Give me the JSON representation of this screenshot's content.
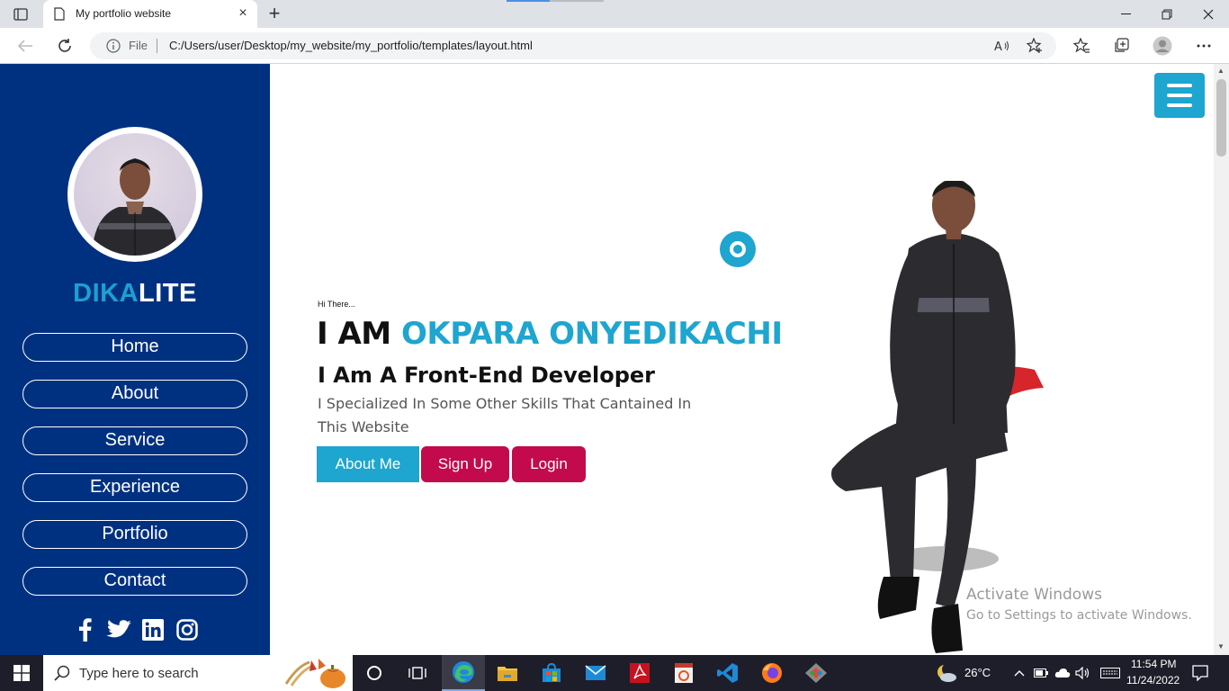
{
  "browser": {
    "tab_title": "My portfolio website",
    "new_tab": "+",
    "close_tab": "×",
    "address_label": "File",
    "url": "C:/Users/user/Desktop/my_website/my_portfolio/templates/layout.html"
  },
  "site": {
    "brand_part1": "DIKA",
    "brand_part2": "LITE",
    "nav": [
      "Home",
      "About",
      "Service",
      "Experience",
      "Portfolio",
      "Contact"
    ],
    "socials": [
      "facebook-icon",
      "twitter-icon",
      "linkedin-icon",
      "instagram-icon"
    ],
    "hero": {
      "greeting": "Hi There...",
      "headline_prefix": "I AM ",
      "headline_name": "OKPARA ONYEDIKACHI",
      "subtitle": "I Am A Front-End Developer",
      "description": "I Specialized In Some Other Skills That Cantained In This Website",
      "buttons": {
        "about": "About Me",
        "signup": "Sign Up",
        "login": "Login"
      }
    },
    "colors": {
      "sidebar": "#003181",
      "accent": "#1ea5d0",
      "cta": "#c20a4d"
    }
  },
  "watermark": {
    "line1": "Activate Windows",
    "line2": "Go to Settings to activate Windows."
  },
  "taskbar": {
    "search_placeholder": "Type here to search",
    "weather": "26°C",
    "time": "11:54 PM",
    "date": "11/24/2022"
  }
}
